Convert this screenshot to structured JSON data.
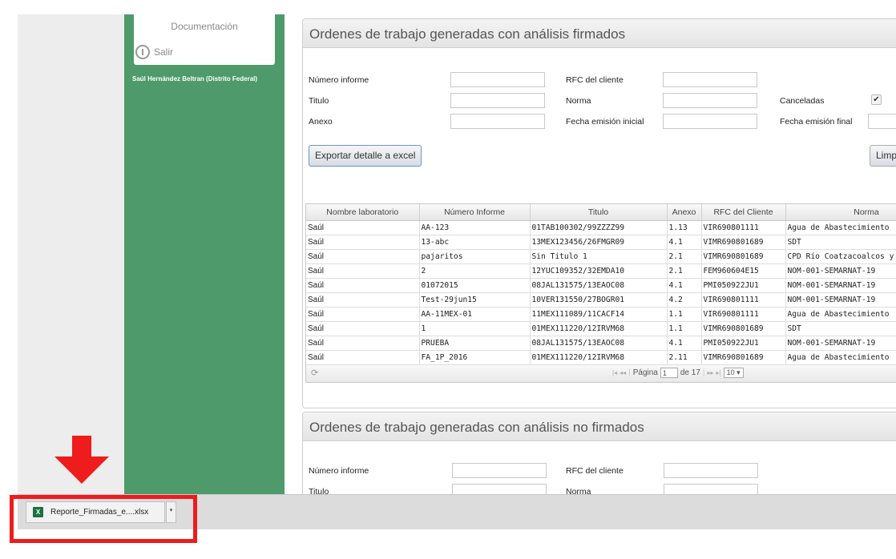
{
  "sidebar": {
    "menu": {
      "documentation": "Documentación",
      "exit": "Salir"
    },
    "user_name": "Saúl Hernández Beltran (Distrito Federal)"
  },
  "signed_panel": {
    "title": "Ordenes de trabajo generadas con análisis firmados",
    "filters": {
      "report_number_label": "Número informe",
      "client_rfc_label": "RFC del cliente",
      "title_label": "Titulo",
      "standard_label": "Norma",
      "cancelled_label": "Canceladas",
      "cancelled_checked": true,
      "annex_label": "Anexo",
      "initial_date_label": "Fecha emisión inicial",
      "final_date_label": "Fecha emisión final"
    },
    "export_button": "Exportar detalle a excel",
    "clear_button": "Limp",
    "grid": {
      "columns": [
        "Nombre laboratorio",
        "Número Informe",
        "Titulo",
        "Anexo",
        "RFC del Cliente",
        "Norma"
      ],
      "rows": [
        [
          "Saúl",
          "AA-123",
          "01TAB100302/99ZZZZ99",
          "1.13",
          "VIR690801111",
          "Agua de Abastecimiento"
        ],
        [
          "Saúl",
          "13-abc",
          "13MEX123456/26FMGR09",
          "4.1",
          "VIMR690801689",
          "SDT"
        ],
        [
          "Saúl",
          "pajaritos",
          "Sin Titulo 1",
          "2.1",
          "VIMR690801689",
          "CPD Río Coatzacoalcos y"
        ],
        [
          "Saúl",
          "2",
          "12YUC109352/32EMDA10",
          "2.1",
          "FEM960604E15",
          "NOM-001-SEMARNAT-19"
        ],
        [
          "Saúl",
          "01072015",
          "08JAL131575/13EAOC08",
          "4.1",
          "PMI050922JU1",
          "NOM-001-SEMARNAT-19"
        ],
        [
          "Saúl",
          "Test-29jun15",
          "10VER131550/27BOGR01",
          "4.2",
          "VIR690801111",
          "NOM-001-SEMARNAT-19"
        ],
        [
          "Saúl",
          "AA-11MEX-01",
          "11MEX111089/11CACF14",
          "1.1",
          "VIR690801111",
          "Agua de Abastecimiento"
        ],
        [
          "Saúl",
          "1",
          "01MEX111220/12IRVM68",
          "1.1",
          "VIMR690801689",
          "SDT"
        ],
        [
          "Saúl",
          "PRUEBA",
          "08JAL131575/13EAOC08",
          "4.1",
          "PMI050922JU1",
          "NOM-001-SEMARNAT-19"
        ],
        [
          "Saúl",
          "FA_1P_2016",
          "01MEX111220/12IRVM68",
          "2.11",
          "VIMR690801689",
          "Agua de Abastecimiento"
        ]
      ]
    },
    "pager": {
      "page_label": "Página",
      "current_page": "1",
      "of_label": "de 17",
      "page_size": "10"
    }
  },
  "unsigned_panel": {
    "title": "Ordenes de trabajo generadas con análisis no firmados",
    "filters": {
      "report_number_label": "Número informe",
      "client_rfc_label": "RFC del cliente",
      "title_label": "Titulo",
      "standard_label": "Norma"
    }
  },
  "download_bar": {
    "file_name": "Reporte_Firmadas_e....xlsx",
    "file_icon": "excel-icon"
  },
  "colors": {
    "sidebar_green": "#4e9a6a",
    "annotation_red": "#ee1c1c",
    "excel_green": "#1e7145"
  }
}
